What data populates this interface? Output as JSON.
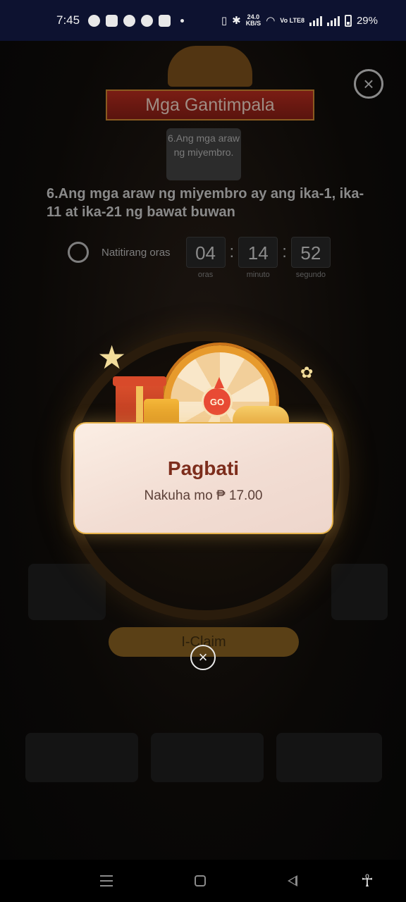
{
  "status_bar": {
    "time": "7:45",
    "net_speed_value": "24.0",
    "net_speed_unit": "KB/S",
    "network_label": "Vo LTE8",
    "battery_percent": "29%",
    "icons": [
      "telegram-icon",
      "discord-icon",
      "whatsapp-icon",
      "messenger-icon",
      "app-icon",
      "dot-icon",
      "vibrate-icon",
      "bluetooth-icon",
      "wifi-icon",
      "signal-icon",
      "battery-icon"
    ]
  },
  "background": {
    "banner_title": "Mga Gantimpala",
    "tooltip": "6.Ang mga araw ng miyembro.",
    "heading": "6.Ang mga araw ng miyembro ay ang ika-1, ika-11 at ika-21 ng bawat buwan",
    "timer": {
      "label": "Natitirang oras",
      "hours": "04",
      "minutes": "14",
      "seconds": "52",
      "hours_label": "oras",
      "minutes_label": "minuto",
      "seconds_label": "segundo",
      "separator": ":"
    },
    "claim_button": "I-Claim"
  },
  "modal": {
    "title": "Pagbati",
    "message": "Nakuha mo ₱ 17.00",
    "go_label": "GO"
  },
  "close_button": "×",
  "nav": {
    "icons": [
      "menu-icon",
      "home-icon",
      "back-icon",
      "accessibility-icon"
    ]
  },
  "colors": {
    "status_bar": "#0d1230",
    "modal_title": "#7d2d1c",
    "modal_border": "#e6b24a",
    "ribbon": "#7a1d14"
  }
}
